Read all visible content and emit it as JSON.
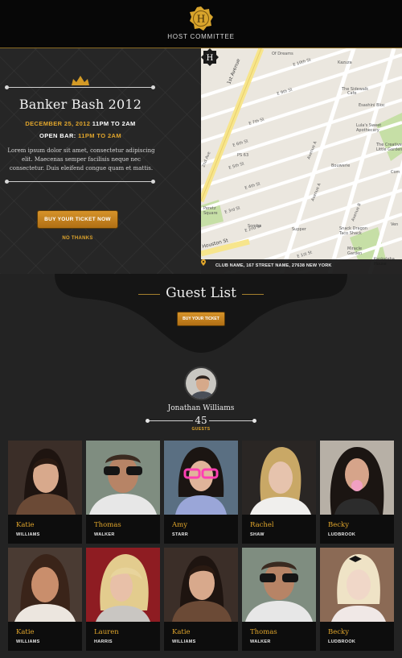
{
  "header": {
    "brand": "HOST COMMITTEE"
  },
  "event": {
    "title": "Banker Bash 2012",
    "date": "DECEMBER 25, 2012",
    "time": "11PM TO 2AM",
    "open_bar_label": "OPEN BAR:",
    "open_bar_time": "11PM TO 2AM",
    "description": "Lorem ipsum dolor sit amet, consectetur adipiscing elit. Maecenas semper facilisis neque nec consectetur. Duis eleifend congue quam et mattis.",
    "buy_label": "BUY YOUR TICKET NOW",
    "no_thanks_label": "NO THANKS"
  },
  "map": {
    "address": "CLUB NAME, 167 STREET NAME, 27638 NEW YORK",
    "labels": {
      "first_avenue": "1st Avenue",
      "avenue_a": "Avenue A",
      "avenue_b": "Avenue B",
      "second_ave": "2nd Ave",
      "houston": "Houston St",
      "e10": "E 10th St",
      "e9": "E 9th St",
      "e7": "E 7th St",
      "e6": "E 6th St",
      "e5": "E 5th St",
      "e4": "E 4th St",
      "e3": "E 3rd St",
      "e2": "E 2nd St",
      "e1": "E 1st St",
      "dreams": "Of Dreams",
      "kazuza": "Kazuza",
      "sidewalk": "The Sidewalk Cafe",
      "essen": "Esashini Bloc",
      "lulus": "Lula's Sweet Apothecary",
      "creative": "The Creative Little Garden",
      "bouwerie": "Bouwerie",
      "ps63": "PS 63",
      "peretz": "Peretz Square",
      "sombe": "Sombe",
      "supper": "Supper",
      "snack": "Snack Dragon Taco Shack",
      "miracle": "Miracle Garden",
      "kenkeleba": "Kenkeleba House",
      "com": "Com",
      "ven": "Ven"
    },
    "colors": {
      "street": "#ffffff",
      "avenue": "#f7e58c",
      "land": "#ebe7df",
      "park": "#c6dfa6"
    }
  },
  "guest_list": {
    "title": "Guest List",
    "buy_label": "BUY YOUR TICKET",
    "host_name": "Jonathan Williams",
    "count": "45",
    "count_label": "GUESTS",
    "guests": [
      {
        "first": "Katie",
        "last": "WILLIAMS"
      },
      {
        "first": "Thomas",
        "last": "WALKER"
      },
      {
        "first": "Amy",
        "last": "STARR"
      },
      {
        "first": "Rachel",
        "last": "SHAW"
      },
      {
        "first": "Becky",
        "last": "LUDBROOK"
      },
      {
        "first": "Katie",
        "last": "WILLIAMS"
      },
      {
        "first": "Lauren",
        "last": "HARRIS"
      },
      {
        "first": "Katie",
        "last": "WILLIAMS"
      },
      {
        "first": "Thomas",
        "last": "WALKER"
      },
      {
        "first": "Becky",
        "last": "LUDBROOK"
      }
    ]
  },
  "colors": {
    "accent": "#e0a52c",
    "dark": "#070707"
  }
}
